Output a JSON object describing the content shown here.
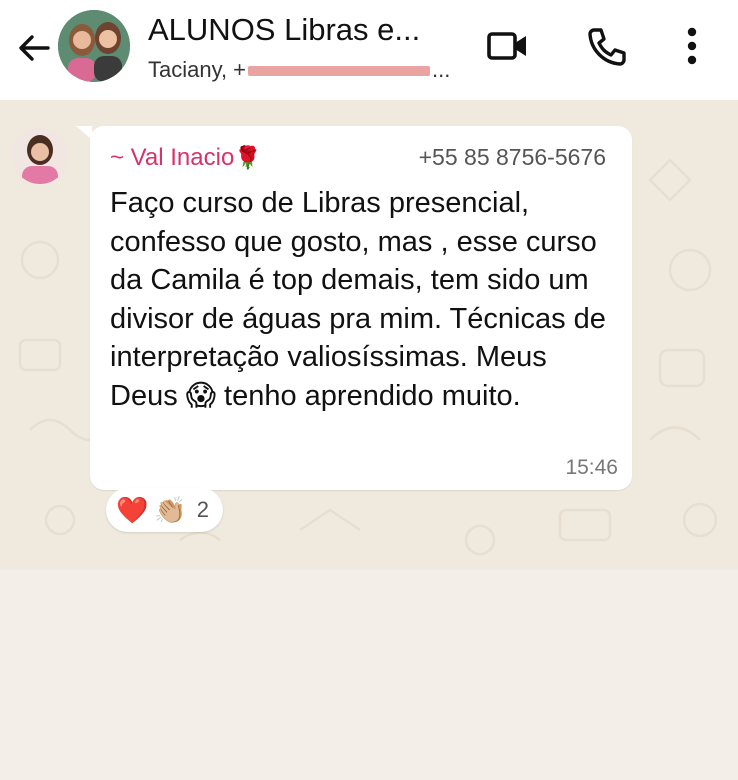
{
  "header": {
    "back_icon": "arrow-left-icon",
    "title": "ALUNOS Libras e...",
    "subtitle_prefix": "Taciany, +",
    "subtitle_suffix": "...",
    "actions": [
      "video-call-icon",
      "phone-icon",
      "more-vert-icon"
    ]
  },
  "message": {
    "sender_name": "~ Val Inacio",
    "sender_emoji": "🌹",
    "sender_phone": "+55 85 8756-5676",
    "text": "Faço curso de Libras presencial, confesso que gosto, mas , esse curso da Camila é top demais, tem sido um divisor de águas pra mim. Técnicas de interpretação valiosíssimas. Meus  Deus 😱 tenho aprendido muito.",
    "time": "15:46"
  },
  "reactions": {
    "emojis": [
      "❤️",
      "👏🏼"
    ],
    "count": "2"
  },
  "colors": {
    "header_bg": "#ffffff",
    "chat_bg": "#efe9de",
    "bubble_bg": "#ffffff",
    "sender_name": "#d6336c",
    "redaction": "#e9a3a0"
  }
}
